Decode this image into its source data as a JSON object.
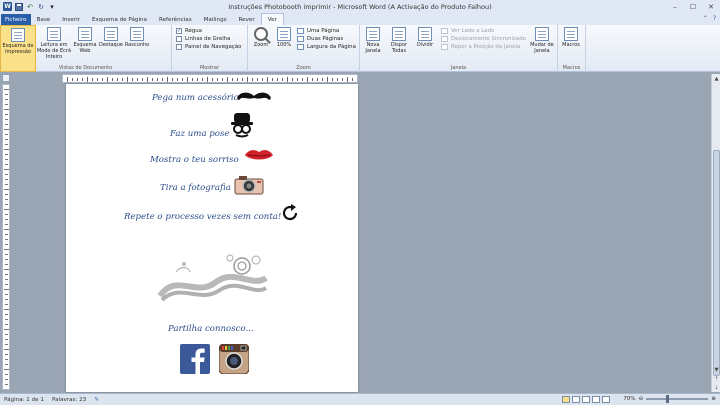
{
  "window": {
    "title": "Instruções Photobooth imprimir  -  Microsoft Word (A Activação do Produto Falhou)",
    "controls": {
      "minimize": "–",
      "maximize": "☐",
      "close": "✕"
    }
  },
  "tabs": [
    "Ficheiro",
    "Base",
    "Inserir",
    "Esquema de Página",
    "Referências",
    "Mailings",
    "Rever",
    "Ver"
  ],
  "active_tab": "Ver",
  "ribbon": {
    "views_group": {
      "label": "Vistas de Documento",
      "buttons": [
        "Esquema de Impressão",
        "Leitura em Modo de Ecrã Inteiro",
        "Esquema Web",
        "Destaque",
        "Rascunho"
      ]
    },
    "show_group": {
      "label": "Mostrar",
      "options": [
        {
          "label": "Régua",
          "checked": true,
          "mark": "✓"
        },
        {
          "label": "Linhas de Grelha",
          "checked": false,
          "mark": ""
        },
        {
          "label": "Painel de Navegação",
          "checked": false,
          "mark": ""
        }
      ]
    },
    "zoom_group": {
      "label": "Zoom",
      "zoom_button": "Zoom",
      "pct_button": "100%",
      "small": [
        "Uma Página",
        "Duas Páginas",
        "Largura da Página"
      ]
    },
    "window_group": {
      "label": "Janela",
      "big": [
        "Nova Janela",
        "Dispor Todas",
        "Dividir"
      ],
      "small": [
        "Ver Lado a Lado",
        "Deslocamento Sincronizado",
        "Repor a Posição da Janela"
      ],
      "switch": "Mudar de Janela"
    },
    "macros_group": {
      "label": "Macros",
      "button": "Macros"
    }
  },
  "document": {
    "lines": [
      "Pega num acessório",
      "Faz uma pose",
      "Mostra o teu sorriso",
      "Tira a fotografia",
      "Repete o processo vezes sem conta!",
      "Partilha connosco..."
    ]
  },
  "status": {
    "page": "Página: 1 de 1",
    "words": "Palavras: 23",
    "zoom": "70%",
    "zoom_level": 0.7
  },
  "colors": {
    "text_blue": "#2a4d8a",
    "file_tab": "#2a5da8",
    "facebook": "#3b5998",
    "lips": "#d0202a"
  }
}
